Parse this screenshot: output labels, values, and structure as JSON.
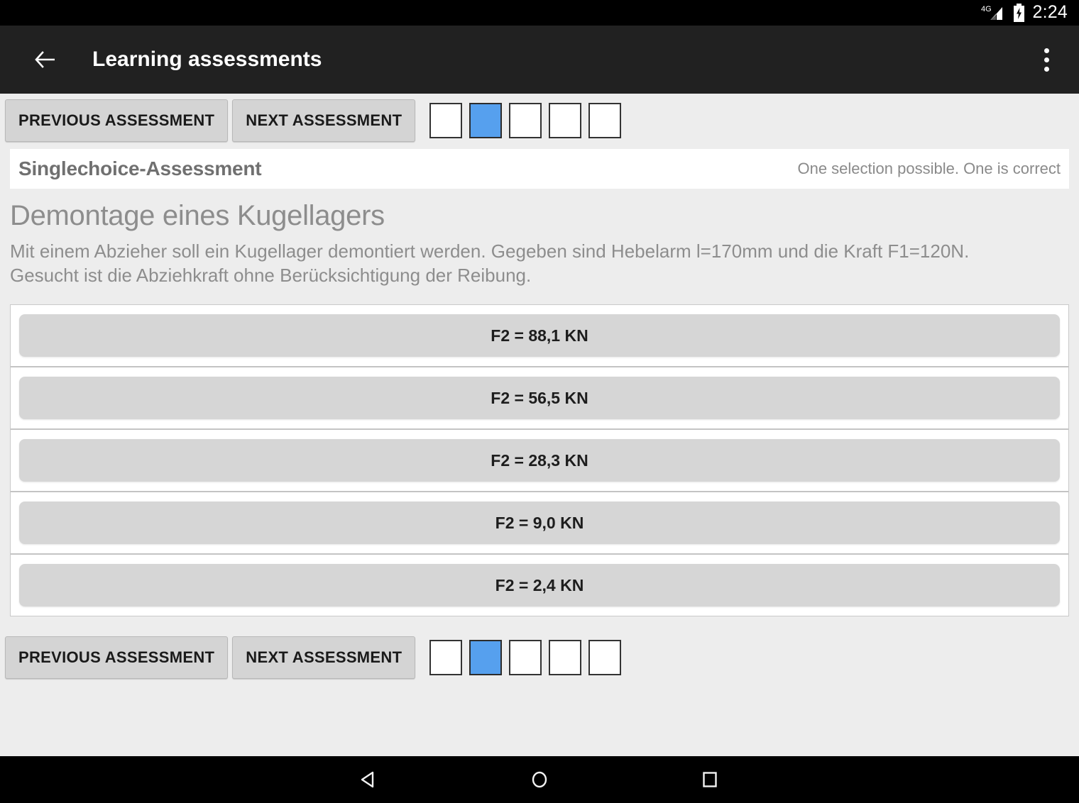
{
  "status_bar": {
    "network_label": "4G",
    "signal_icon": "signal-cellular-icon",
    "battery_icon": "battery-charging-icon",
    "time": "2:24"
  },
  "app_bar": {
    "back_icon": "back-arrow-icon",
    "title": "Learning assessments",
    "overflow_icon": "overflow-menu-icon"
  },
  "nav": {
    "previous_label": "PREVIOUS ASSESSMENT",
    "next_label": "NEXT ASSESSMENT",
    "pager": [
      {
        "index": "1",
        "active": false
      },
      {
        "index": "2",
        "active": true
      },
      {
        "index": "3",
        "active": false
      },
      {
        "index": "4",
        "active": false
      },
      {
        "index": "5",
        "active": false
      }
    ],
    "active_color": "#56a0ee",
    "inactive_color": "#ffffff"
  },
  "assessment": {
    "type_label": "Singlechoice-Assessment",
    "hint": "One selection possible. One is correct",
    "title": "Demontage eines Kugellagers",
    "description": "Mit einem Abzieher soll ein Kugellager demontiert werden. Gegeben sind Hebelarm l=170mm und die Kraft F1=120N. Gesucht ist die Abziehkraft ohne Berücksichtigung der Reibung.",
    "options": [
      {
        "label": "F2 = 88,1 KN"
      },
      {
        "label": "F2 = 56,5 KN"
      },
      {
        "label": "F2 = 28,3 KN"
      },
      {
        "label": "F2 = 9,0 KN"
      },
      {
        "label": "F2 = 2,4 KN"
      }
    ]
  },
  "system_nav": {
    "back_icon": "system-back-icon",
    "home_icon": "system-home-icon",
    "recents_icon": "system-recents-icon"
  }
}
